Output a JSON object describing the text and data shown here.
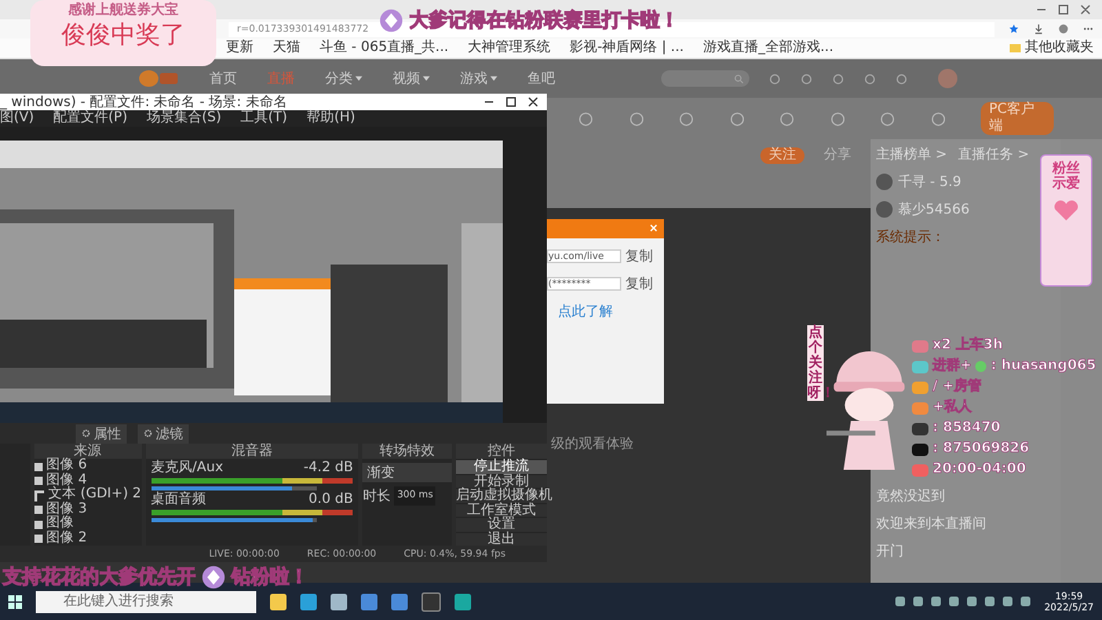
{
  "browser": {
    "address": "r=0.017339301491483772",
    "bookmarks": [
      "更新",
      "天猫",
      "斗鱼 - 065直播_共...",
      "大神管理系统",
      "影视-神盾网络 | ...",
      "游戏直播_全部游戏..."
    ],
    "other_bookmarks": "其他收藏夹"
  },
  "site": {
    "nav": [
      {
        "label": "首页",
        "selected": false,
        "menu": false
      },
      {
        "label": "直播",
        "selected": true,
        "menu": false
      },
      {
        "label": "分类",
        "selected": false,
        "menu": true
      },
      {
        "label": "视频",
        "selected": false,
        "menu": true
      },
      {
        "label": "游戏",
        "selected": false,
        "menu": true
      },
      {
        "label": "鱼吧",
        "selected": false,
        "menu": false
      }
    ],
    "pc_client": "PC客户端",
    "follow": "关注",
    "share": "分享"
  },
  "dialog": {
    "fields": [
      {
        "text": "yu.com/live",
        "action": "复制"
      },
      {
        "text": "(********",
        "action": "复制"
      }
    ],
    "link": "点此了解"
  },
  "video_note": "级的观看体验",
  "chat": {
    "links": [
      "主播榜单 >",
      "直播任务 >"
    ],
    "ranks": [
      {
        "name": "千寻 - 5.9"
      },
      {
        "name": "慕少54566"
      }
    ],
    "system": "系统提示：",
    "messages": [
      {
        "text": "竟然没迟到"
      },
      {
        "text": "欢迎来到本直播间"
      },
      {
        "text": "开门"
      }
    ]
  },
  "obs": {
    "title": "_ windows) - 配置文件: 未命名 - 场景: 未命名",
    "menu": [
      "图(V)",
      "配置文件(P)",
      "场景集合(S)",
      "工具(T)",
      "帮助(H)"
    ],
    "source_buttons": [
      "属性",
      "滤镜"
    ],
    "sources_title": "来源",
    "sources": [
      {
        "kind": "image",
        "name": "图像 6"
      },
      {
        "kind": "image",
        "name": "图像 4"
      },
      {
        "kind": "text",
        "name": "文本 (GDI+) 2"
      },
      {
        "kind": "image",
        "name": "图像 3"
      },
      {
        "kind": "image",
        "name": "图像"
      },
      {
        "kind": "image",
        "name": "图像 2"
      }
    ],
    "mixer_title": "混音器",
    "channels": [
      {
        "name": "麦克风/Aux",
        "reading": "-4.2 dB",
        "level": 0.85
      },
      {
        "name": "桌面音频",
        "reading": "0.0 dB",
        "level": 0.98
      }
    ],
    "transition_title": "转场特效",
    "transition": "渐变",
    "duration_label": "时长",
    "duration": "300 ms",
    "controls_title": "控件",
    "controls": [
      {
        "label": "停止推流",
        "selected": true
      },
      {
        "label": "开始录制",
        "selected": false
      },
      {
        "label": "启动虚拟摄像机",
        "selected": false
      },
      {
        "label": "工作室模式",
        "selected": false
      },
      {
        "label": "设置",
        "selected": false
      },
      {
        "label": "退出",
        "selected": false
      }
    ],
    "status": [
      "LIVE: 00:00:00",
      "REC: 00:00:00",
      "CPU: 0.4%, 59.94 fps"
    ]
  },
  "overlays": {
    "thanks": "感谢上舰送券大宝",
    "winner": "俊俊中奖了",
    "top_banner": "大爹记得在钻粉联赛里打卡啦！",
    "bottom_banner": [
      "支持花花的大爹优先开",
      "钻粉啦！"
    ],
    "follow_hint": "点个关注呀！",
    "fan_card": "粉丝示爱",
    "info": [
      {
        "kind": "car",
        "text": "x2 上车3h"
      },
      {
        "kind": "group",
        "text": "进群+",
        "tail": ": huasang065"
      },
      {
        "kind": "manager",
        "text": "/ +房管"
      },
      {
        "kind": "private",
        "text": "+私人"
      },
      {
        "kind": "qq",
        "text": ": 858470"
      },
      {
        "kind": "tiktok",
        "text": ": 875069826"
      },
      {
        "kind": "clock",
        "text": "20:00-04:00"
      }
    ]
  },
  "taskbar": {
    "search": {
      "placeholder": "在此键入进行搜索"
    },
    "time": "19:59",
    "date": "2022/5/27"
  }
}
